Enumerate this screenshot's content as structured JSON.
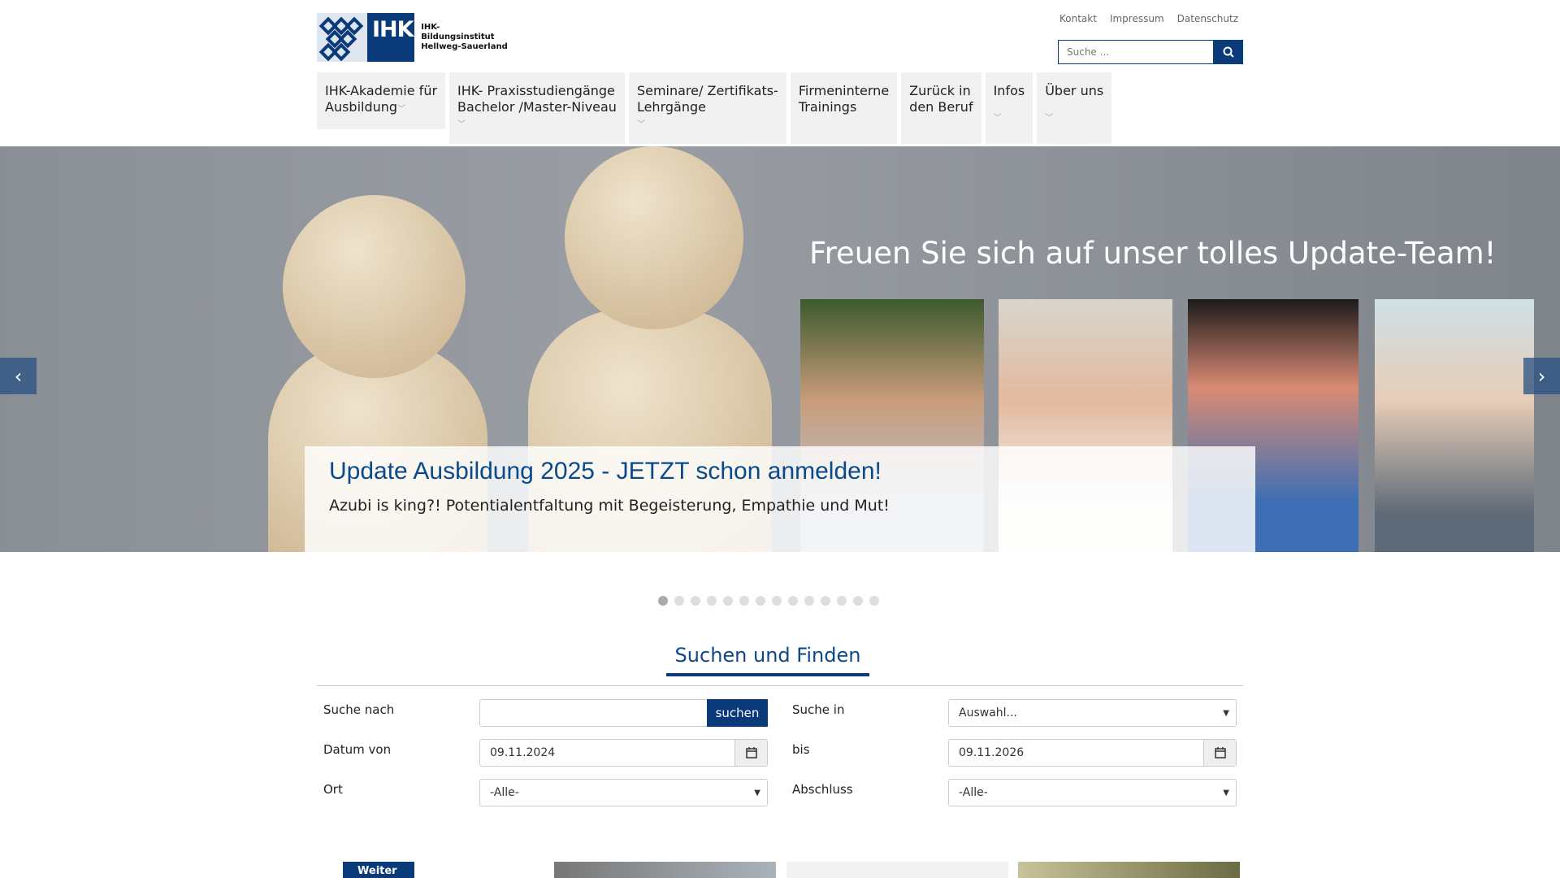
{
  "logo": {
    "mark_text": "IHK",
    "line1": "IHK-Bildungsinstitut",
    "line2": "Hellweg-Sauerland"
  },
  "topnav": [
    "Kontakt",
    "Impressum",
    "Datenschutz"
  ],
  "search": {
    "placeholder": "Suche ..."
  },
  "mainnav": [
    {
      "line1": "IHK-Akademie für",
      "line2": "Ausbildung"
    },
    {
      "line1": "IHK- Praxisstudiengänge",
      "line2": "Bachelor /Master-Niveau"
    },
    {
      "line1": "Seminare/ Zertifikats-",
      "line2": "Lehrgänge"
    },
    {
      "line1": "Firmeninterne",
      "line2": "Trainings"
    },
    {
      "line1": "Zurück in",
      "line2": "den Beruf"
    },
    {
      "line1": "Infos",
      "line2": ""
    },
    {
      "line1": "Über uns",
      "line2": ""
    }
  ],
  "hero": {
    "title": "Freuen Sie sich auf unser tolles Update-Team!",
    "caption_title": "Update Ausbildung 2025 - JETZT schon anmelden!",
    "caption_text": "Azubi is king?! Potentialentfaltung mit Begeisterung, Empathie und Mut!",
    "slides_total": 14,
    "active_slide": 1
  },
  "search_section": {
    "title": "Suchen und Finden",
    "labels": {
      "suche_nach": "Suche nach",
      "suche_in": "Suche in",
      "datum_von": "Datum von",
      "bis": "bis",
      "ort": "Ort",
      "abschluss": "Abschluss"
    },
    "button": "suchen",
    "suche_in_value": "Auswahl...",
    "datum_von_value": "09.11.2024",
    "bis_value": "09.11.2026",
    "ort_value": "-Alle-",
    "abschluss_value": "-Alle-"
  },
  "teaser": {
    "first_label": "Weiter"
  }
}
